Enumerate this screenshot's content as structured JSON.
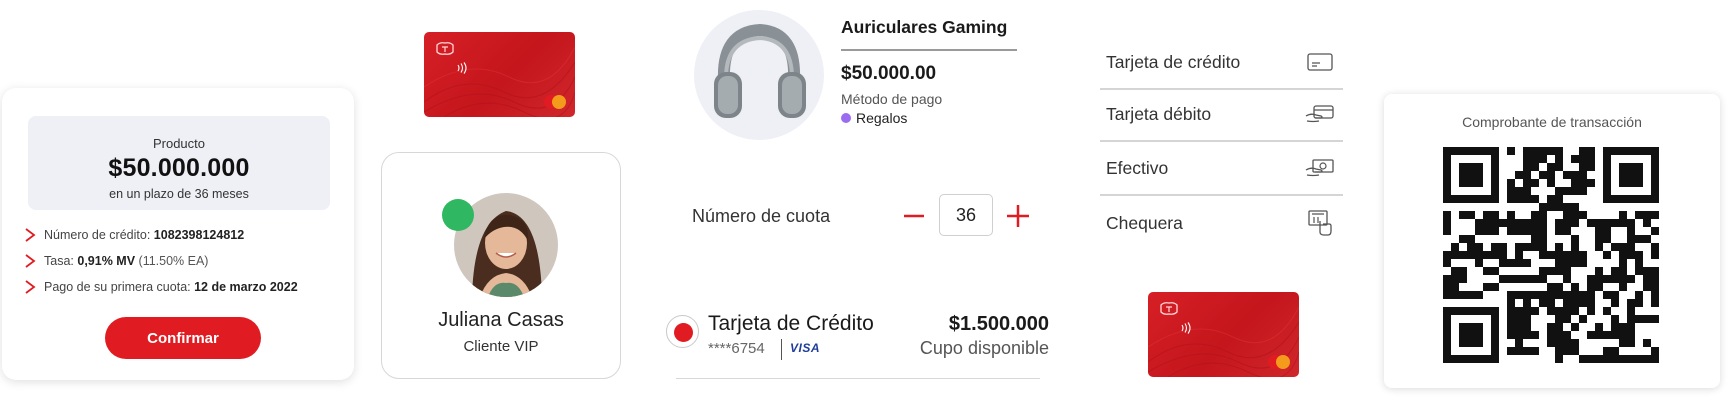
{
  "credit_summary": {
    "product_label": "Producto",
    "product_amount": "$50.000.000",
    "product_term": "en un plazo de 36 meses",
    "details": [
      {
        "label": "Número de crédito:",
        "value": "1082398124812",
        "extra": ""
      },
      {
        "label": "Tasa:",
        "value": "0,91% MV",
        "extra": "(11.50% EA)"
      },
      {
        "label": "Pago de su primera cuota:",
        "value": "12 de marzo 2022",
        "extra": ""
      }
    ],
    "confirm_label": "Confirmar"
  },
  "profile": {
    "name": "Juliana Casas",
    "subtitle": "Cliente VIP",
    "status_color": "#2fb861"
  },
  "product": {
    "title": "Auriculares Gaming",
    "price": "$50.000.00",
    "method_label": "Método de pago",
    "method_value": "Regalos",
    "method_color": "#9b6cf0"
  },
  "installments": {
    "label": "Número de cuota",
    "value": "36",
    "minus_icon": "minus-icon",
    "plus_icon": "plus-icon"
  },
  "credit_card": {
    "title": "Tarjeta de Crédito",
    "number": "****6754",
    "brand": "VISA",
    "amount": "$1.500.000",
    "amount_label": "Cupo disponible"
  },
  "payment_methods": [
    {
      "label": "Tarjeta de crédito",
      "icon": "credit-card-icon"
    },
    {
      "label": "Tarjeta débito",
      "icon": "card-in-hand-icon"
    },
    {
      "label": "Efectivo",
      "icon": "cash-icon"
    },
    {
      "label": "Chequera",
      "icon": "atm-touch-icon"
    }
  ],
  "receipt": {
    "title": "Comprobante de transacción"
  },
  "colors": {
    "accent": "#e01c22",
    "card_red": "#c4161c",
    "surface": "#eef0f5"
  }
}
